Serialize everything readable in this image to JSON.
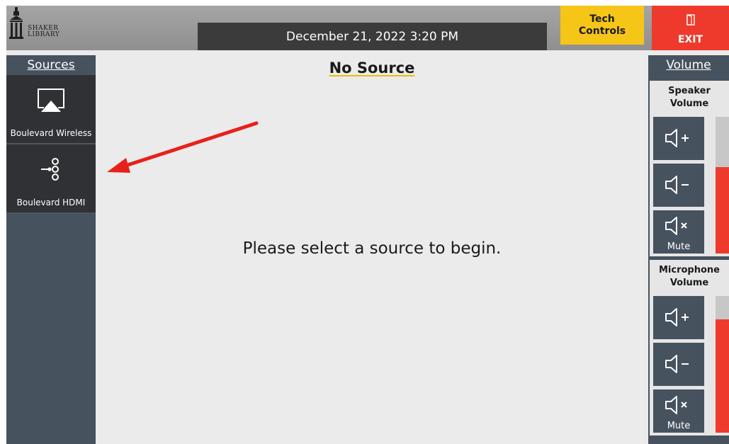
{
  "header": {
    "logo_text_line1": "SHAKER",
    "logo_text_line2": "LIBRARY",
    "datetime": "December 21, 2022 3:20 PM",
    "tech_controls_label": "Tech\nControls",
    "exit_label": "EXIT"
  },
  "sources": {
    "heading": "Sources",
    "items": [
      {
        "label": "Boulevard Wireless",
        "icon": "airplay-icon"
      },
      {
        "label": "Boulevard HDMI",
        "icon": "hdmi-input-icon"
      }
    ]
  },
  "main": {
    "title": "No Source",
    "prompt": "Please select a source to begin."
  },
  "volume": {
    "heading": "Volume",
    "speaker": {
      "title": "Speaker\nVolume",
      "mute_label": "Mute",
      "level_fraction": 0.63
    },
    "microphone": {
      "title": "Microphone\nVolume",
      "mute_label": "Mute",
      "level_fraction": 0.83
    }
  },
  "colors": {
    "tech_controls": "#f5c518",
    "exit": "#ee3a2c",
    "sidebar": "#47525f",
    "level_fill": "#ee3a2c",
    "annotation_arrow": "#e8201b"
  }
}
